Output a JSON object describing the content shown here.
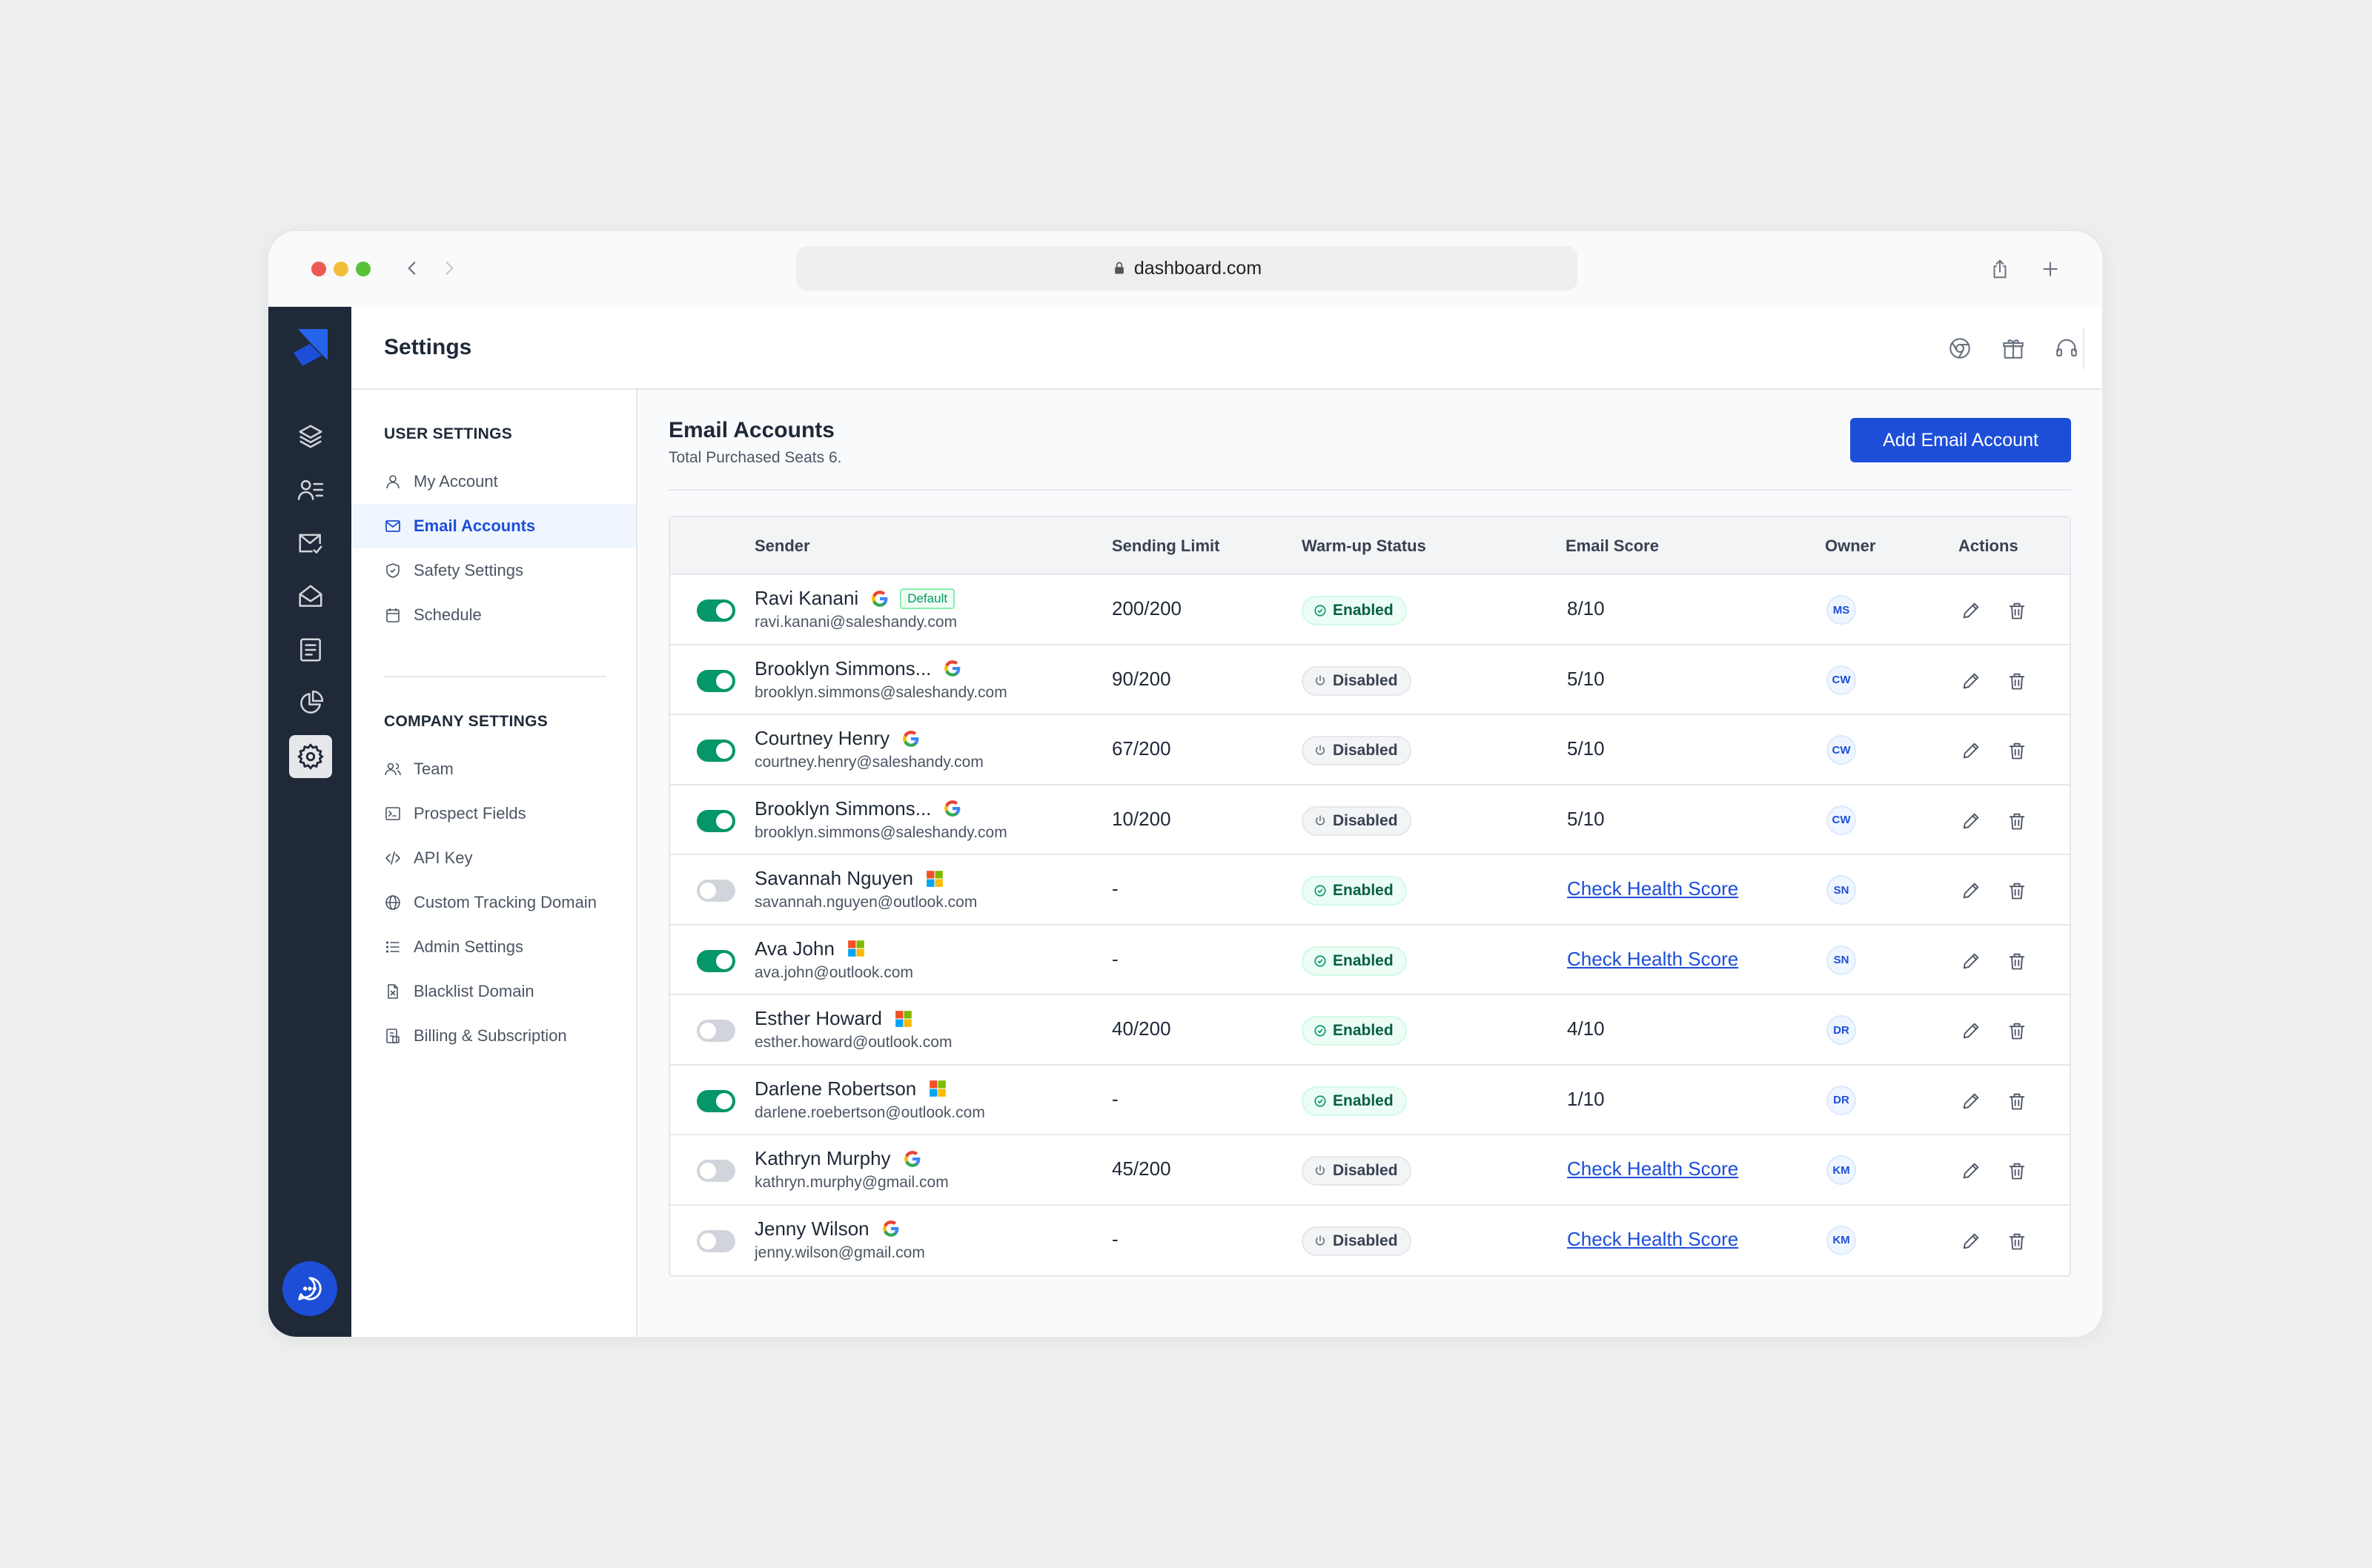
{
  "browser": {
    "url": "dashboard.com"
  },
  "header": {
    "title": "Settings"
  },
  "subnav": {
    "user_heading": "USER SETTINGS",
    "user_items": [
      {
        "label": "My Account",
        "icon": "user-icon"
      },
      {
        "label": "Email Accounts",
        "icon": "mail-icon",
        "active": true
      },
      {
        "label": "Safety Settings",
        "icon": "shield-icon"
      },
      {
        "label": "Schedule",
        "icon": "calendar-icon"
      }
    ],
    "company_heading": "COMPANY SETTINGS",
    "company_items": [
      {
        "label": "Team",
        "icon": "users-icon"
      },
      {
        "label": "Prospect Fields",
        "icon": "terminal-icon"
      },
      {
        "label": "API Key",
        "icon": "code-icon"
      },
      {
        "label": "Custom Tracking Domain",
        "icon": "globe-icon"
      },
      {
        "label": "Admin Settings",
        "icon": "list-icon"
      },
      {
        "label": "Blacklist Domain",
        "icon": "file-x-icon"
      },
      {
        "label": "Billing & Subscription",
        "icon": "receipt-icon"
      }
    ]
  },
  "main": {
    "title": "Email Accounts",
    "subtitle": "Total Purchased Seats 6.",
    "add_button": "Add Email Account"
  },
  "table": {
    "headers": {
      "sender": "Sender",
      "sending_limit": "Sending Limit",
      "warmup": "Warm-up Status",
      "score": "Email Score",
      "owner": "Owner",
      "actions": "Actions"
    },
    "rows": [
      {
        "active": true,
        "name": "Ravi Kanani",
        "provider": "google",
        "badge": "Default",
        "email": "ravi.kanani@saleshandy.com",
        "limit": "200/200",
        "status": "Enabled",
        "score": "8/10",
        "owner": "MS"
      },
      {
        "active": true,
        "name": "Brooklyn Simmons...",
        "provider": "google",
        "badge": "",
        "email": "brooklyn.simmons@saleshandy.com",
        "limit": "90/200",
        "status": "Disabled",
        "score": "5/10",
        "owner": "CW"
      },
      {
        "active": true,
        "name": "Courtney Henry",
        "provider": "google",
        "badge": "",
        "email": "courtney.henry@saleshandy.com",
        "limit": "67/200",
        "status": "Disabled",
        "score": "5/10",
        "owner": "CW"
      },
      {
        "active": true,
        "name": "Brooklyn Simmons...",
        "provider": "google",
        "badge": "",
        "email": "brooklyn.simmons@saleshandy.com",
        "limit": "10/200",
        "status": "Disabled",
        "score": "5/10",
        "owner": "CW"
      },
      {
        "active": false,
        "name": "Savannah Nguyen",
        "provider": "microsoft",
        "badge": "",
        "email": "savannah.nguyen@outlook.com",
        "limit": "-",
        "status": "Enabled",
        "score": "Check Health Score",
        "owner": "SN"
      },
      {
        "active": true,
        "name": "Ava John",
        "provider": "microsoft",
        "badge": "",
        "email": "ava.john@outlook.com",
        "limit": "-",
        "status": "Enabled",
        "score": "Check Health Score",
        "owner": "SN"
      },
      {
        "active": false,
        "name": "Esther Howard",
        "provider": "microsoft",
        "badge": "",
        "email": "esther.howard@outlook.com",
        "limit": "40/200",
        "status": "Enabled",
        "score": "4/10",
        "owner": "DR"
      },
      {
        "active": true,
        "name": "Darlene Robertson",
        "provider": "microsoft",
        "badge": "",
        "email": "darlene.roebertson@outlook.com",
        "limit": "-",
        "status": "Enabled",
        "score": "1/10",
        "owner": "DR"
      },
      {
        "active": false,
        "name": "Kathryn Murphy",
        "provider": "google",
        "badge": "",
        "email": "kathryn.murphy@gmail.com",
        "limit": "45/200",
        "status": "Disabled",
        "score": "Check Health Score",
        "owner": "KM"
      },
      {
        "active": false,
        "name": "Jenny Wilson",
        "provider": "google",
        "badge": "",
        "email": "jenny.wilson@gmail.com",
        "limit": "-",
        "status": "Disabled",
        "score": "Check Health Score",
        "owner": "KM"
      }
    ]
  },
  "colors": {
    "brand": "#1d4ed8",
    "sidebar": "#1f2937",
    "toggle_on": "#059669",
    "enabled": "#065f46"
  }
}
